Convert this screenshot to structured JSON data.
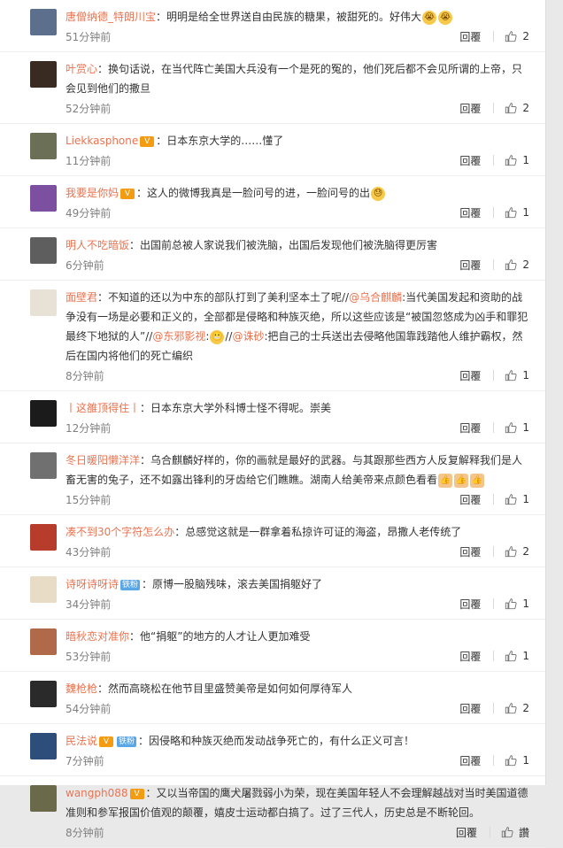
{
  "ui": {
    "reply_label": "回覆"
  },
  "comments": [
    {
      "user": "唐僧纳德_特朗川宝",
      "badges": [],
      "pre": "：明明是给全世界送自由民族的糖果，被甜死的。好伟大",
      "emojis": [
        "cry",
        "cry"
      ],
      "post": "",
      "time": "51分钟前",
      "likes": "2",
      "avatar": "#5c6f8c"
    },
    {
      "user": "叶赏心",
      "badges": [],
      "pre": "：换句话说，在当代阵亡美国大兵没有一个是死的冤的，他们死后都不会见所谓的上帝，只会见到他们的撒旦",
      "emojis": [],
      "post": "",
      "time": "52分钟前",
      "likes": "2",
      "avatar": "#3a2b22"
    },
    {
      "user": "Liekkasphone",
      "badges": [
        "vip"
      ],
      "pre": "：日本东京大学的……懂了",
      "emojis": [],
      "post": "",
      "time": "11分钟前",
      "likes": "1",
      "avatar": "#6b6f55"
    },
    {
      "user": "我要是你妈",
      "badges": [
        "vip"
      ],
      "pre": "：这人的微博我真是一脸问号的进，一脸问号的出",
      "emojis": [
        "confused"
      ],
      "post": "",
      "time": "49分钟前",
      "likes": "1",
      "avatar": "#7d4fa0"
    },
    {
      "user": "明人不吃暗饭",
      "badges": [],
      "pre": "：出国前总被人家说我们被洗脑，出国后发现他们被洗脑得更厉害",
      "emojis": [],
      "post": "",
      "time": "6分钟前",
      "likes": "2",
      "avatar": "#5e5e5e"
    },
    {
      "user": "面壁君",
      "badges": [],
      "segments": [
        {
          "t": "text",
          "v": "：不知道的还以为中东的部队打到了美利坚本土了呢//"
        },
        {
          "t": "mention",
          "v": "@乌合麒麟"
        },
        {
          "t": "text",
          "v": ":当代美国发起和资助的战争没有一场是必要和正义的，全部都是侵略和种族灭绝，所以这些应该是“被国忽悠成为凶手和罪犯最终下地狱的人”//"
        },
        {
          "t": "mention",
          "v": "@东邪影视"
        },
        {
          "t": "text",
          "v": ":"
        },
        {
          "t": "emoji",
          "v": "smile"
        },
        {
          "t": "text",
          "v": "//"
        },
        {
          "t": "mention",
          "v": "@诛砂"
        },
        {
          "t": "text",
          "v": ":把自己的士兵送出去侵略他国靠践踏他人维护霸权，然后在国内将他们的死亡编织"
        }
      ],
      "time": "8分钟前",
      "likes": "1",
      "avatar": "#e8e2d6"
    },
    {
      "user": "丨这雒顶得住丨",
      "badges": [],
      "pre": "：日本东京大学外科博士怪不得呢。崇美",
      "emojis": [],
      "post": "",
      "time": "12分钟前",
      "likes": "1",
      "avatar": "#1b1b1b"
    },
    {
      "user": "冬日暖阳懒洋洋",
      "badges": [],
      "pre": "：乌合麒麟好样的，你的画就是最好的武器。与其跟那些西方人反复解释我们是人畜无害的兔子，还不如露出锋利的牙齿给它们瞧瞧。湖南人给美帝来点颜色看看",
      "emojis": [
        "thumb",
        "thumb",
        "thumb"
      ],
      "post": "",
      "time": "15分钟前",
      "likes": "1",
      "avatar": "#707070"
    },
    {
      "user": "凑不到30个字符怎么办",
      "badges": [],
      "pre": "：总感觉这就是一群拿着私掠许可证的海盗，昂撒人老传统了",
      "emojis": [],
      "post": "",
      "time": "43分钟前",
      "likes": "2",
      "avatar": "#b73c2c"
    },
    {
      "user": "诗呀诗呀诗",
      "badges": [
        "fan"
      ],
      "pre": "：原博一股脑残味，滚去美国捐躯好了",
      "emojis": [],
      "post": "",
      "time": "34分钟前",
      "likes": "1",
      "avatar": "#e9dcc6"
    },
    {
      "user": "暗秋恋对准你",
      "badges": [],
      "pre": "：他“捐躯”的地方的人才让人更加难受",
      "emojis": [],
      "post": "",
      "time": "53分钟前",
      "likes": "1",
      "avatar": "#b06a4a"
    },
    {
      "user": "魏枪枪",
      "badges": [],
      "pre": "：然而高晓松在他节目里盛赞美帝是如何如何厚待军人",
      "emojis": [],
      "post": "",
      "time": "54分钟前",
      "likes": "2",
      "avatar": "#2a2a2a"
    },
    {
      "user": "民法说",
      "badges": [
        "vip",
        "fan"
      ],
      "pre": "：因侵略和种族灭绝而发动战争死亡的，有什么正义可言！",
      "emojis": [],
      "post": "",
      "time": "7分钟前",
      "likes": "1",
      "avatar": "#2d4e7a"
    },
    {
      "user": "wangph088",
      "badges": [
        "vip"
      ],
      "pre": "：又以当帝国的鹰犬屠戮弱小为荣，现在美国年轻人不会理解越战对当时美国道德准则和参军报国价值观的颠覆，嬉皮士运动都白搞了。过了三代人，历史总是不断轮回。",
      "emojis": [],
      "post": "",
      "time": "8分钟前",
      "likes": "讚",
      "avatar": "#6a6a4a"
    }
  ],
  "badge_labels": {
    "vip": "V",
    "fan": "铁粉"
  },
  "colors": {
    "username": "#eb7350",
    "meta": "#808080",
    "border": "#eeeeee"
  }
}
